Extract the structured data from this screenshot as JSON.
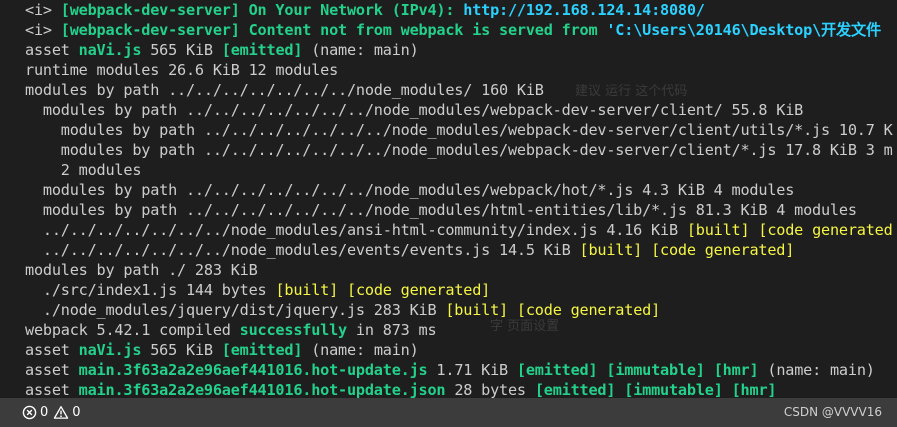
{
  "terminal": {
    "lines": [
      [
        {
          "t": "<i> ",
          "c": "default"
        },
        {
          "t": "[webpack-dev-server] On Your Network (IPv4): ",
          "c": "green"
        },
        {
          "t": "http://192.168.124.14:8080/",
          "c": "url"
        }
      ],
      [
        {
          "t": "<i> ",
          "c": "default"
        },
        {
          "t": "[webpack-dev-server] Content not from webpack is served from ",
          "c": "green"
        },
        {
          "t": "'C:\\Users\\20146\\Desktop\\开发文件",
          "c": "url"
        }
      ],
      [
        {
          "t": "asset ",
          "c": "default"
        },
        {
          "t": "naVi.js",
          "c": "green"
        },
        {
          "t": " 565 KiB ",
          "c": "default"
        },
        {
          "t": "[emitted]",
          "c": "green"
        },
        {
          "t": " (name: main)",
          "c": "default"
        }
      ],
      [
        {
          "t": "runtime modules 26.6 KiB 12 modules",
          "c": "default"
        }
      ],
      [
        {
          "t": "modules by path ../../../../../../../node_modules/ 160 KiB",
          "c": "default"
        }
      ],
      [
        {
          "t": "  modules by path ../../../../../../../node_modules/webpack-dev-server/client/ 55.8 KiB",
          "c": "default"
        }
      ],
      [
        {
          "t": "    modules by path ../../../../../../../node_modules/webpack-dev-server/client/utils/*.js 10.7 K",
          "c": "default"
        }
      ],
      [
        {
          "t": "    modules by path ../../../../../../../node_modules/webpack-dev-server/client/*.js 17.8 KiB 3 m",
          "c": "default"
        }
      ],
      [
        {
          "t": "    2 modules",
          "c": "default"
        }
      ],
      [
        {
          "t": "  modules by path ../../../../../../../node_modules/webpack/hot/*.js 4.3 KiB 4 modules",
          "c": "default"
        }
      ],
      [
        {
          "t": "  modules by path ../../../../../../../node_modules/html-entities/lib/*.js 81.3 KiB 4 modules",
          "c": "default"
        }
      ],
      [
        {
          "t": "  ../../../../../../../node_modules/ansi-html-community/index.js 4.16 KiB ",
          "c": "default"
        },
        {
          "t": "[built]",
          "c": "yellow"
        },
        {
          "t": " ",
          "c": "default"
        },
        {
          "t": "[code generated",
          "c": "yellow"
        }
      ],
      [
        {
          "t": "  ../../../../../../../node_modules/events/events.js 14.5 KiB ",
          "c": "default"
        },
        {
          "t": "[built]",
          "c": "yellow"
        },
        {
          "t": " ",
          "c": "default"
        },
        {
          "t": "[code generated]",
          "c": "yellow"
        }
      ],
      [
        {
          "t": "modules by path ./ 283 KiB",
          "c": "default"
        }
      ],
      [
        {
          "t": "  ./src/index1.js 144 bytes ",
          "c": "default"
        },
        {
          "t": "[built]",
          "c": "yellow"
        },
        {
          "t": " ",
          "c": "default"
        },
        {
          "t": "[code generated]",
          "c": "yellow"
        }
      ],
      [
        {
          "t": "  ./node_modules/jquery/dist/jquery.js 283 KiB ",
          "c": "default"
        },
        {
          "t": "[built]",
          "c": "yellow"
        },
        {
          "t": " ",
          "c": "default"
        },
        {
          "t": "[code generated]",
          "c": "yellow"
        }
      ],
      [
        {
          "t": "webpack 5.42.1 compiled ",
          "c": "default"
        },
        {
          "t": "successfully",
          "c": "green"
        },
        {
          "t": " in 873 ms",
          "c": "default"
        }
      ],
      [
        {
          "t": "asset ",
          "c": "default"
        },
        {
          "t": "naVi.js",
          "c": "green"
        },
        {
          "t": " 565 KiB ",
          "c": "default"
        },
        {
          "t": "[emitted]",
          "c": "green"
        },
        {
          "t": " (name: main)",
          "c": "default"
        }
      ],
      [
        {
          "t": "asset ",
          "c": "default"
        },
        {
          "t": "main.3f63a2a2e96aef441016.hot-update.js",
          "c": "green"
        },
        {
          "t": " 1.71 KiB ",
          "c": "default"
        },
        {
          "t": "[emitted]",
          "c": "green"
        },
        {
          "t": " ",
          "c": "default"
        },
        {
          "t": "[immutable]",
          "c": "green"
        },
        {
          "t": " ",
          "c": "default"
        },
        {
          "t": "[hmr]",
          "c": "green"
        },
        {
          "t": " (name: main)",
          "c": "default"
        }
      ],
      [
        {
          "t": "asset ",
          "c": "default"
        },
        {
          "t": "main.3f63a2a2e96aef441016.hot-update.json",
          "c": "green"
        },
        {
          "t": " 28 bytes ",
          "c": "default"
        },
        {
          "t": "[emitted]",
          "c": "green"
        },
        {
          "t": " ",
          "c": "default"
        },
        {
          "t": "[immutable]",
          "c": "green"
        },
        {
          "t": " ",
          "c": "default"
        },
        {
          "t": "[hmr]",
          "c": "green"
        }
      ]
    ]
  },
  "statusbar": {
    "errors_count": "0",
    "warnings_count": "0",
    "error_icon": "error-circle-icon",
    "warning_icon": "warning-triangle-icon"
  },
  "watermark": "CSDN @VVVV16",
  "colors": {
    "background": "#1e1e1e",
    "statusbar": "#3c3c3c",
    "text": "#cccccc",
    "green": "#23d18b",
    "yellow": "#f5f543",
    "url": "#2bd1ff"
  }
}
